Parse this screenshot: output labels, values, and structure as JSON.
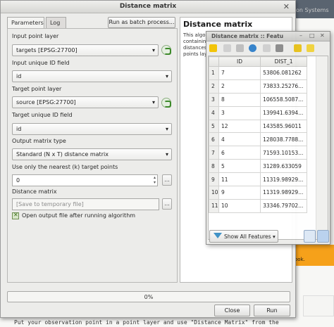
{
  "background": {
    "header_text": "on Systems",
    "orange_text": "ook.",
    "bottom_text": "Put your observation point in a point layer and use \"Distance Matrix\" from the"
  },
  "dialog": {
    "title": "Distance matrix",
    "close_icon": "close-icon",
    "tabs": [
      {
        "label": "Parameters",
        "active": true
      },
      {
        "label": "Log",
        "active": false
      }
    ],
    "batch_button": "Run as batch process...",
    "params": {
      "input_layer_label": "Input point layer",
      "input_layer_value": "targets [EPSG:27700]",
      "input_id_label": "Input unique ID field",
      "input_id_value": "id",
      "target_layer_label": "Target point layer",
      "target_layer_value": "source [EPSG:27700]",
      "target_id_label": "Target unique ID field",
      "target_id_value": "id",
      "matrix_type_label": "Output matrix type",
      "matrix_type_value": "Standard (N x T) distance matrix",
      "nearest_label": "Use only the nearest (k) target points",
      "nearest_value": "0",
      "ellipsis": "...",
      "output_label": "Distance matrix",
      "output_placeholder": "[Save to temporary file]",
      "open_output_label": "Open output file after running algorithm",
      "open_output_checked": true
    },
    "help": {
      "title": "Distance matrix",
      "body": "This algo containin distances points lay"
    },
    "progress": {
      "text": "0%",
      "value": 0
    },
    "close_button": "Close",
    "run_button": "Run"
  },
  "attribute_table": {
    "title": "Distance matrix :: Featu",
    "window_controls": {
      "minimize": "–",
      "maximize": "□",
      "close": "✕"
    },
    "columns": [
      "ID",
      "DIST_1"
    ],
    "rows": [
      {
        "n": "1",
        "id": "7",
        "dist": "53806.081262"
      },
      {
        "n": "2",
        "id": "2",
        "dist": "73833.25276..."
      },
      {
        "n": "3",
        "id": "8",
        "dist": "106558.5087..."
      },
      {
        "n": "4",
        "id": "3",
        "dist": "139941.6394..."
      },
      {
        "n": "5",
        "id": "12",
        "dist": "143585.96011"
      },
      {
        "n": "6",
        "id": "4",
        "dist": "128038.7788..."
      },
      {
        "n": "7",
        "id": "6",
        "dist": "71593.10153..."
      },
      {
        "n": "8",
        "id": "5",
        "dist": "31289.633059"
      },
      {
        "n": "9",
        "id": "11",
        "dist": "11319.98929..."
      },
      {
        "n": "10",
        "id": "9",
        "dist": "11319.98929..."
      },
      {
        "n": "11",
        "id": "10",
        "dist": "33346.79702..."
      }
    ],
    "show_all_button": "Show All Features",
    "colors": {
      "selection_blue": "#3a8fc5",
      "accent_yellow": "#e8c21a"
    }
  }
}
